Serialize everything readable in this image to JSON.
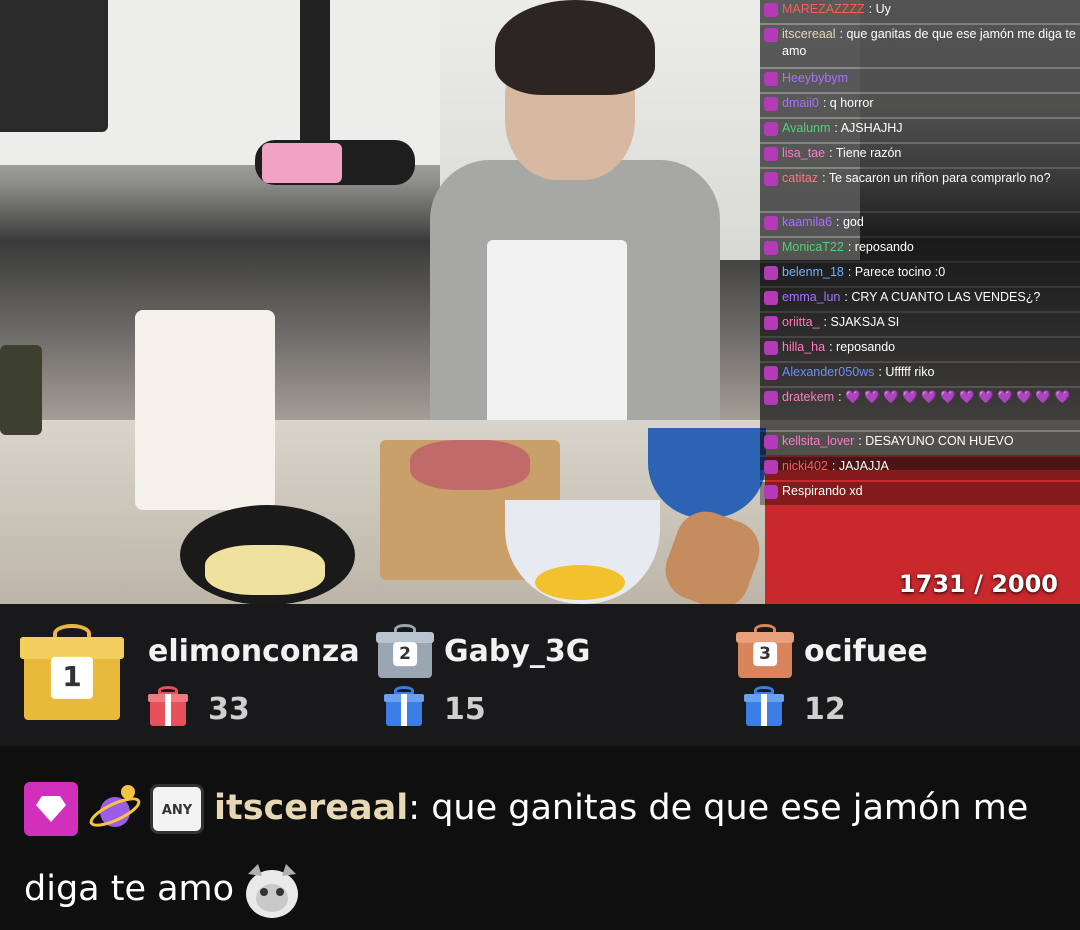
{
  "stream": {
    "sub_goal": "1731 / 2000",
    "chat": [
      {
        "user": "MAREZAZZZZ",
        "user_color": "#ff5b5b",
        "message": "Uy"
      },
      {
        "user": "itscereaal",
        "user_color": "#e8d7b4",
        "message": "que ganitas de que ese jamón me diga te amo",
        "tall": true
      },
      {
        "user": "Heeybybym",
        "user_color": "#a970ff",
        "message": ""
      },
      {
        "user": "dmaii0",
        "user_color": "#a970ff",
        "message": "q horror"
      },
      {
        "user": "Avalunm",
        "user_color": "#4fd17a",
        "message": "AJSHAJHJ"
      },
      {
        "user": "lisa_tae",
        "user_color": "#ff7ac6",
        "message": "Tiene razón"
      },
      {
        "user": "catitaz",
        "user_color": "#ff7a7a",
        "message": "Te sacaron un riñon para comprarlo no?",
        "tall": true
      },
      {
        "user": "kaamila6",
        "user_color": "#a970ff",
        "message": "god"
      },
      {
        "user": "MonicaT22",
        "user_color": "#4fd17a",
        "message": "reposando"
      },
      {
        "user": "belenm_18",
        "user_color": "#6fb2ff",
        "message": "Parece tocino :0"
      },
      {
        "user": "emma_lun",
        "user_color": "#a970ff",
        "message": "CRY A CUANTO LAS VENDES¿?"
      },
      {
        "user": "oriitta_",
        "user_color": "#ff7ac6",
        "message": "SJAKSJA SI"
      },
      {
        "user": "hilla_ha",
        "user_color": "#ff7ac6",
        "message": "reposando"
      },
      {
        "user": "Alexander050ws",
        "user_color": "#6f8bff",
        "message": "Ufffff riko"
      },
      {
        "user": "dratekem",
        "user_color": "#ff7ac6",
        "message": "💜 💜 💜 💜 💜 💜 💜 💜 💜 💜 💜 💜",
        "tall": true
      },
      {
        "user": "kellsita_lover",
        "user_color": "#ff7ac6",
        "message": "DESAYUNO CON HUEVO"
      },
      {
        "user": "nicki402",
        "user_color": "#ff5b5b",
        "message": "JAJAJJA"
      },
      {
        "user": "",
        "user_color": "#cccccc",
        "message": "Respirando xd"
      }
    ]
  },
  "gifters": [
    {
      "rank": "1",
      "name": "elimonconza",
      "count": "33",
      "box_color": "#e8b93a",
      "lid_color": "#f3cf5d"
    },
    {
      "rank": "2",
      "name": "Gaby_3G",
      "count": "15",
      "box_color": "#9aa6b2",
      "lid_color": "#b9c4cf"
    },
    {
      "rank": "3",
      "name": "ocifuee",
      "count": "12",
      "box_color": "#d9845b",
      "lid_color": "#e7a07c"
    }
  ],
  "gift_icon_colors": {
    "first": "#e8505b",
    "second": "#3a7ee6",
    "third": "#3a7ee6"
  },
  "message": {
    "user": "itscereaal",
    "line1": "que ganitas de que ese jamón me",
    "line2": "diga te amo",
    "badge_any": "ANY"
  }
}
